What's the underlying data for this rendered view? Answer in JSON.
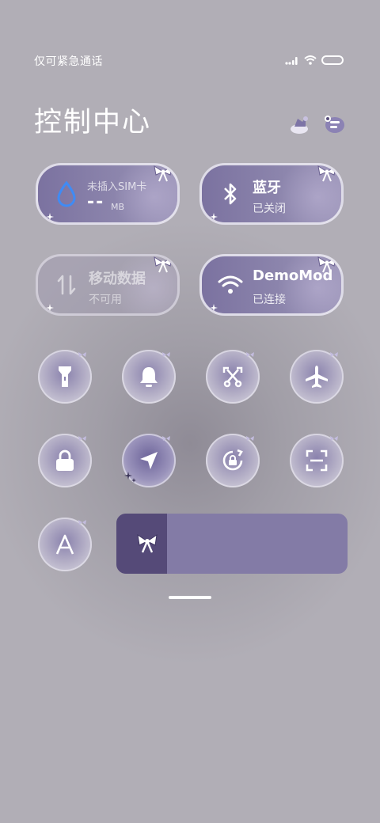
{
  "status_bar": {
    "carrier": "仅可紧急通话",
    "icons": [
      "signal-icon",
      "wifi-icon",
      "battery-icon"
    ]
  },
  "header": {
    "title": "控制中心",
    "icons": [
      "theme-icon",
      "edit-icon"
    ]
  },
  "tiles": {
    "data_usage": {
      "label": "未插入SIM卡",
      "value": "--",
      "unit": "MB",
      "icon": "water-drop-icon"
    },
    "bluetooth": {
      "label": "蓝牙",
      "status": "已关闭",
      "icon": "bluetooth-icon"
    },
    "mobile_data": {
      "label": "移动数据",
      "status": "不可用",
      "icon": "mobile-data-icon"
    },
    "wifi": {
      "label": "DemoMod",
      "status": "已连接",
      "icon": "wifi-icon"
    }
  },
  "toggles": [
    {
      "name": "flashlight",
      "icon": "flashlight-icon"
    },
    {
      "name": "notification",
      "icon": "bell-icon"
    },
    {
      "name": "screenshot",
      "icon": "scissors-icon"
    },
    {
      "name": "airplane-mode",
      "icon": "airplane-icon"
    },
    {
      "name": "lock-screen",
      "icon": "lock-icon"
    },
    {
      "name": "location",
      "icon": "location-arrow-icon"
    },
    {
      "name": "rotation-lock",
      "icon": "rotation-lock-icon"
    },
    {
      "name": "scanner",
      "icon": "scan-icon"
    },
    {
      "name": "auto-brightness",
      "icon": "auto-brightness-icon"
    }
  ],
  "brightness": {
    "level": 0.22,
    "icon": "bow-icon"
  },
  "colors": {
    "tile": "#8d86ad",
    "slider_track": "#837ba6",
    "slider_fill": "#554a78",
    "accent_blue": "#3f8bf5"
  }
}
